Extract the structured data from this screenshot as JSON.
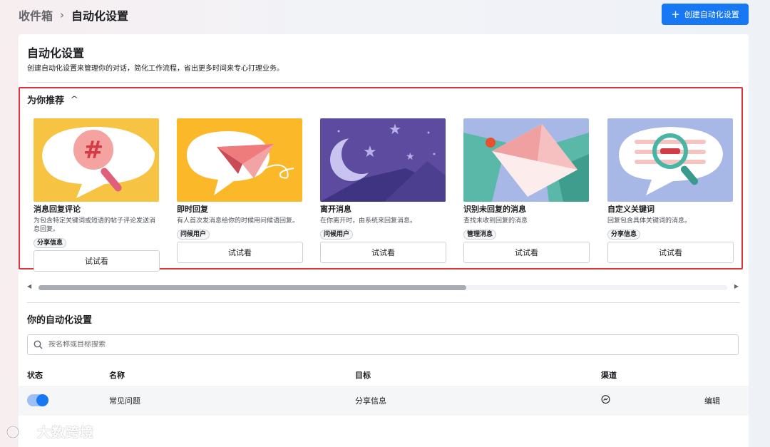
{
  "breadcrumb": {
    "root": "收件箱",
    "separator": "›",
    "current": "自动化设置"
  },
  "header": {
    "create_button": "创建自动化设置"
  },
  "intro": {
    "title": "自动化设置",
    "description": "创建自动化设置来管理你的对话，简化工作流程，省出更多时间来专心打理业务。"
  },
  "recommended": {
    "title": "为你推荐",
    "tiles": [
      {
        "title": "消息回复评论",
        "desc": "为包含特定关键词或短语的帖子评论发送消息回复。",
        "tag": "分享信息",
        "button": "试试看",
        "image": "hashtag-magnifier"
      },
      {
        "title": "即时回复",
        "desc": "有人首次发消息给你的时候用问候语回复。",
        "tag": "问候用户",
        "button": "试试看",
        "image": "paper-plane"
      },
      {
        "title": "离开消息",
        "desc": "在你离开时，由系统来回复消息。",
        "tag": "问候用户",
        "button": "试试看",
        "image": "moon-stars"
      },
      {
        "title": "识别未回复的消息",
        "desc": "查找未收到回复的消息",
        "tag": "管理消息",
        "button": "试试看",
        "image": "envelopes"
      },
      {
        "title": "自定义关键词",
        "desc": "回复包含具体关键词的消息。",
        "tag": "分享信息",
        "button": "试试看",
        "image": "keyword-magnifier"
      }
    ]
  },
  "yours": {
    "title": "你的自动化设置",
    "search_placeholder": "按名称或目标搜索",
    "columns": {
      "status": "状态",
      "name": "名称",
      "goal": "目标",
      "channel": "渠道"
    },
    "rows": [
      {
        "enabled": true,
        "name": "常见问题",
        "goal": "分享信息",
        "channel_icon": "messenger-icon",
        "action": "编辑"
      }
    ]
  },
  "watermark": "大数跨境",
  "colors": {
    "primary": "#1877f2",
    "highlight_border": "#d9363e",
    "yellow": "#f7c342",
    "purple": "#5c4b9e",
    "teal": "#5ab8a8"
  }
}
